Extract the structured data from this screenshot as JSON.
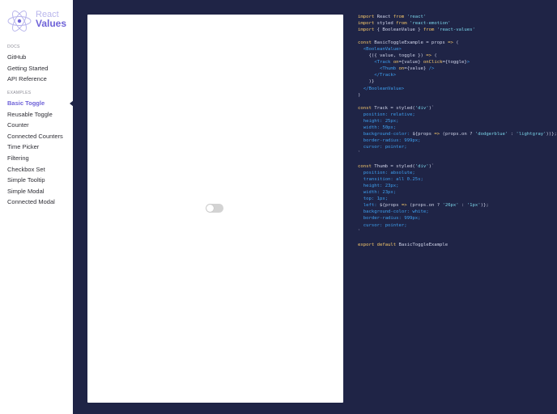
{
  "logo": {
    "line1": "React",
    "line2": "Values"
  },
  "sidebar": {
    "docs_label": "DOCS",
    "docs": [
      {
        "label": "GitHub"
      },
      {
        "label": "Getting Started"
      },
      {
        "label": "API Reference"
      }
    ],
    "examples_label": "EXAMPLES",
    "examples": [
      {
        "label": "Basic Toggle",
        "active": true
      },
      {
        "label": "Reusable Toggle"
      },
      {
        "label": "Counter"
      },
      {
        "label": "Connected Counters"
      },
      {
        "label": "Time Picker"
      },
      {
        "label": "Filtering"
      },
      {
        "label": "Checkbox Set"
      },
      {
        "label": "Simple Tooltip"
      },
      {
        "label": "Simple Modal"
      },
      {
        "label": "Connected Modal"
      }
    ]
  },
  "preview": {
    "toggle_on": false
  },
  "code": {
    "lines": [
      [
        [
          "kw",
          "import"
        ],
        [
          "t",
          " React "
        ],
        [
          "kw",
          "from"
        ],
        [
          "t",
          " "
        ],
        [
          "str",
          "'react'"
        ]
      ],
      [
        [
          "kw",
          "import"
        ],
        [
          "t",
          " styled "
        ],
        [
          "kw",
          "from"
        ],
        [
          "t",
          " "
        ],
        [
          "str",
          "'react-emotion'"
        ]
      ],
      [
        [
          "kw",
          "import"
        ],
        [
          "t",
          " { BooleanValue } "
        ],
        [
          "kw",
          "from"
        ],
        [
          "t",
          " "
        ],
        [
          "str",
          "'react-values'"
        ]
      ],
      [],
      [
        [
          "kw",
          "const"
        ],
        [
          "t",
          " BasicToggleExample = props "
        ],
        [
          "kw",
          "=>"
        ],
        [
          "t",
          " ("
        ]
      ],
      [
        [
          "t",
          "  "
        ],
        [
          "tag",
          "<BooleanValue>"
        ]
      ],
      [
        [
          "t",
          "    {({ value, toggle }) "
        ],
        [
          "kw",
          "=>"
        ],
        [
          "t",
          " ("
        ]
      ],
      [
        [
          "t",
          "      "
        ],
        [
          "tag",
          "<Track"
        ],
        [
          "t",
          " "
        ],
        [
          "kw",
          "on"
        ],
        [
          "t",
          "={value} "
        ],
        [
          "kw",
          "onClick"
        ],
        [
          "t",
          "={toggle}"
        ],
        [
          "tag",
          ">"
        ]
      ],
      [
        [
          "t",
          "        "
        ],
        [
          "tag",
          "<Thumb"
        ],
        [
          "t",
          " "
        ],
        [
          "kw",
          "on"
        ],
        [
          "t",
          "={value} "
        ],
        [
          "tag",
          "/>"
        ]
      ],
      [
        [
          "t",
          "      "
        ],
        [
          "tag",
          "</Track>"
        ]
      ],
      [
        [
          "t",
          "    )}"
        ]
      ],
      [
        [
          "t",
          "  "
        ],
        [
          "tag",
          "</BooleanValue>"
        ]
      ],
      [
        [
          "t",
          ")"
        ]
      ],
      [],
      [
        [
          "kw",
          "const"
        ],
        [
          "t",
          " Track = styled("
        ],
        [
          "str",
          "'div'"
        ],
        [
          "t",
          ")`"
        ]
      ],
      [
        [
          "t",
          "  "
        ],
        [
          "prop",
          "position: relative;"
        ]
      ],
      [
        [
          "t",
          "  "
        ],
        [
          "prop",
          "height: 25px;"
        ]
      ],
      [
        [
          "t",
          "  "
        ],
        [
          "prop",
          "width: 50px;"
        ]
      ],
      [
        [
          "t",
          "  "
        ],
        [
          "prop",
          "background-color: "
        ],
        [
          "t",
          "${props "
        ],
        [
          "kw",
          "=>"
        ],
        [
          "t",
          " (props.on ? "
        ],
        [
          "str",
          "'dodgerblue'"
        ],
        [
          "t",
          " : "
        ],
        [
          "str",
          "'lightgray'"
        ],
        [
          "t",
          "))};"
        ]
      ],
      [
        [
          "t",
          "  "
        ],
        [
          "prop",
          "border-radius: 999px;"
        ]
      ],
      [
        [
          "t",
          "  "
        ],
        [
          "prop",
          "cursor: pointer;"
        ]
      ],
      [
        [
          "t",
          "`"
        ]
      ],
      [],
      [
        [
          "kw",
          "const"
        ],
        [
          "t",
          " Thumb = styled("
        ],
        [
          "str",
          "'div'"
        ],
        [
          "t",
          ")`"
        ]
      ],
      [
        [
          "t",
          "  "
        ],
        [
          "prop",
          "position: absolute;"
        ]
      ],
      [
        [
          "t",
          "  "
        ],
        [
          "prop",
          "transition: all 0.25s;"
        ]
      ],
      [
        [
          "t",
          "  "
        ],
        [
          "prop",
          "height: 23px;"
        ]
      ],
      [
        [
          "t",
          "  "
        ],
        [
          "prop",
          "width: 23px;"
        ]
      ],
      [
        [
          "t",
          "  "
        ],
        [
          "prop",
          "top: 1px;"
        ]
      ],
      [
        [
          "t",
          "  "
        ],
        [
          "prop",
          "left: "
        ],
        [
          "t",
          "${props "
        ],
        [
          "kw",
          "=>"
        ],
        [
          "t",
          " (props.on ? "
        ],
        [
          "str",
          "'26px'"
        ],
        [
          "t",
          " : "
        ],
        [
          "str",
          "'1px'"
        ],
        [
          "t",
          ")};"
        ]
      ],
      [
        [
          "t",
          "  "
        ],
        [
          "prop",
          "background-color: white;"
        ]
      ],
      [
        [
          "t",
          "  "
        ],
        [
          "prop",
          "border-radius: 999px;"
        ]
      ],
      [
        [
          "t",
          "  "
        ],
        [
          "prop",
          "cursor: pointer;"
        ]
      ],
      [
        [
          "t",
          "`"
        ]
      ],
      [],
      [
        [
          "kw",
          "export default"
        ],
        [
          "t",
          " BasicToggleExample"
        ]
      ]
    ]
  },
  "colors": {
    "accent": "#6f63d8",
    "background": "#1f2446",
    "keyword": "#f6c86b",
    "string": "#7ad3e8",
    "tag": "#3ea0f0"
  }
}
